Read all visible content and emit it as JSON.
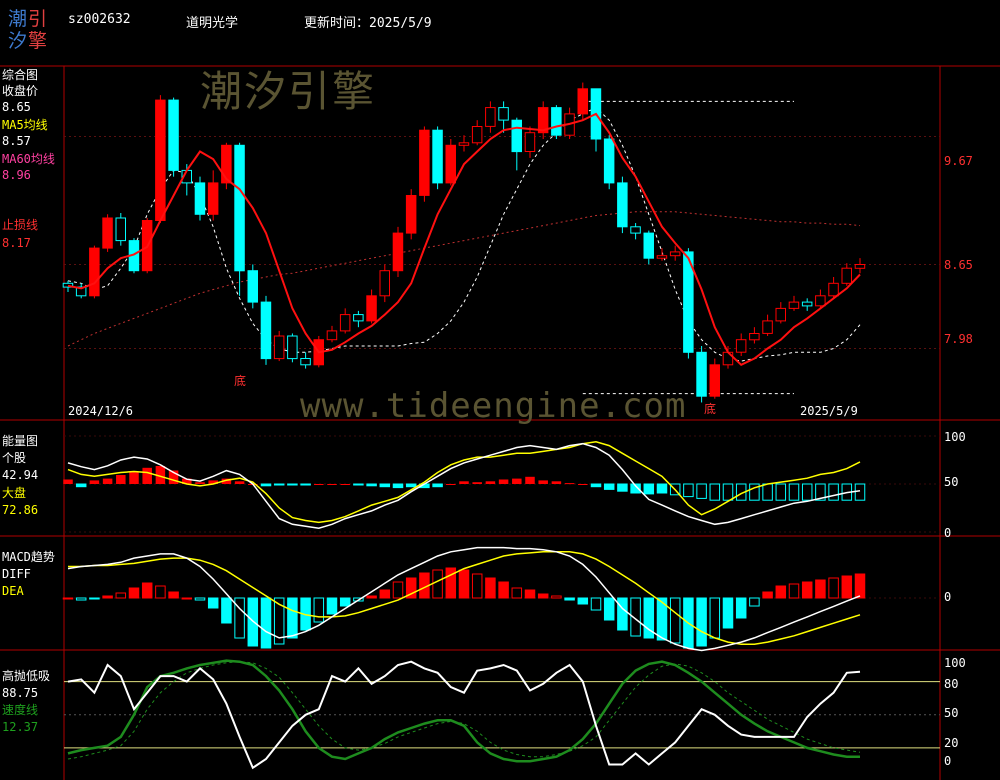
{
  "header": {
    "logo_chars": [
      "潮",
      "引",
      "汐",
      "擎"
    ],
    "code": "sz002632",
    "name": "道明光学",
    "update_label": "更新时间：",
    "update_date": "2025/5/9"
  },
  "watermark": {
    "text_cn": "潮汐引擎",
    "url": "www.tideengine.com"
  },
  "colors": {
    "up": "#ff0000",
    "down": "#00ffff",
    "ma5": "#ffffff",
    "ma60": "#ff3030",
    "stop": "#ff0000",
    "yellow": "#ffff00",
    "green": "#1e8c1e",
    "axis": "#b00000"
  },
  "panel_main": {
    "labels": {
      "title": "综合图",
      "close_label": "收盘价",
      "close_value": "8.65",
      "ma5_label": "MA5均线",
      "ma5_value": "8.57",
      "ma60_label": "MA60均线",
      "ma60_value": "8.96",
      "stop_label": "止损线",
      "stop_value": "8.17"
    },
    "start_date": "2024/12/6",
    "end_date": "2025/5/9",
    "bottom_markers": [
      {
        "label": "底",
        "index": 10
      },
      {
        "label": "底",
        "index": 39
      }
    ]
  },
  "panel_energy": {
    "labels": {
      "title": "能量图",
      "stock_label": "个股",
      "stock_value": "42.94",
      "market_label": "大盘",
      "market_value": "72.86"
    }
  },
  "panel_macd": {
    "labels": {
      "title": "MACD趋势",
      "diff_label": "DIFF",
      "dea_label": "DEA"
    }
  },
  "panel_gd": {
    "labels": {
      "title": "高抛低吸",
      "value1": "88.75",
      "speed_label": "速度线",
      "speed_value": "12.37"
    }
  },
  "chart_data": [
    {
      "name": "综合图",
      "type": "candlestick",
      "x_start": "2024/12/6",
      "x_end": "2025/5/9",
      "y_ticks": [
        "9.67",
        "8.65",
        "7.98"
      ],
      "candles": [
        [
          8.5,
          8.47,
          8.52,
          8.43
        ],
        [
          8.47,
          8.4,
          8.5,
          8.38
        ],
        [
          8.4,
          8.78,
          8.8,
          8.38
        ],
        [
          8.78,
          9.02,
          9.05,
          8.75
        ],
        [
          9.02,
          8.84,
          9.06,
          8.8
        ],
        [
          8.84,
          8.6,
          8.86,
          8.58
        ],
        [
          8.6,
          9.0,
          9.02,
          8.58
        ],
        [
          9.0,
          9.96,
          10.0,
          8.98
        ],
        [
          9.96,
          9.4,
          9.98,
          9.35
        ],
        [
          9.4,
          9.3,
          9.45,
          9.2
        ],
        [
          9.3,
          9.05,
          9.35,
          9.0
        ],
        [
          9.05,
          9.3,
          9.4,
          9.0
        ],
        [
          9.3,
          9.6,
          9.62,
          9.25
        ],
        [
          9.6,
          8.6,
          9.62,
          8.4
        ],
        [
          8.6,
          8.35,
          8.65,
          8.3
        ],
        [
          8.35,
          7.9,
          8.4,
          7.85
        ],
        [
          7.9,
          8.08,
          8.12,
          7.88
        ],
        [
          8.08,
          7.9,
          8.1,
          7.87
        ],
        [
          7.9,
          7.85,
          7.95,
          7.82
        ],
        [
          7.85,
          8.05,
          8.08,
          7.83
        ],
        [
          8.05,
          8.12,
          8.16,
          8.03
        ],
        [
          8.12,
          8.25,
          8.3,
          8.1
        ],
        [
          8.25,
          8.2,
          8.28,
          8.15
        ],
        [
          8.2,
          8.4,
          8.45,
          8.18
        ],
        [
          8.4,
          8.6,
          8.65,
          8.35
        ],
        [
          8.6,
          8.9,
          8.95,
          8.55
        ],
        [
          8.9,
          9.2,
          9.25,
          8.85
        ],
        [
          9.2,
          9.72,
          9.75,
          9.15
        ],
        [
          9.72,
          9.3,
          9.75,
          9.25
        ],
        [
          9.3,
          9.6,
          9.65,
          9.28
        ],
        [
          9.6,
          9.62,
          9.68,
          9.55
        ],
        [
          9.62,
          9.75,
          9.8,
          9.6
        ],
        [
          9.75,
          9.9,
          9.95,
          9.7
        ],
        [
          9.9,
          9.8,
          9.95,
          9.7
        ],
        [
          9.8,
          9.55,
          9.82,
          9.4
        ],
        [
          9.55,
          9.7,
          9.75,
          9.5
        ],
        [
          9.7,
          9.9,
          9.95,
          9.65
        ],
        [
          9.9,
          9.68,
          9.92,
          9.65
        ],
        [
          9.68,
          9.85,
          9.9,
          9.65
        ],
        [
          9.85,
          10.05,
          10.1,
          9.8
        ],
        [
          10.05,
          9.65,
          10.05,
          9.55
        ],
        [
          9.65,
          9.3,
          9.68,
          9.25
        ],
        [
          9.3,
          8.95,
          9.35,
          8.9
        ],
        [
          8.95,
          8.9,
          8.98,
          8.85
        ],
        [
          8.9,
          8.7,
          8.92,
          8.65
        ],
        [
          8.7,
          8.72,
          8.78,
          8.68
        ],
        [
          8.72,
          8.75,
          8.8,
          8.68
        ],
        [
          8.75,
          7.95,
          8.78,
          7.9
        ],
        [
          7.95,
          7.6,
          8.0,
          7.55
        ],
        [
          7.6,
          7.85,
          7.9,
          7.58
        ],
        [
          7.85,
          7.95,
          8.0,
          7.82
        ],
        [
          7.95,
          8.05,
          8.1,
          7.92
        ],
        [
          8.05,
          8.1,
          8.15,
          8.02
        ],
        [
          8.1,
          8.2,
          8.25,
          8.08
        ],
        [
          8.2,
          8.3,
          8.35,
          8.18
        ],
        [
          8.3,
          8.35,
          8.4,
          8.28
        ],
        [
          8.35,
          8.32,
          8.38,
          8.28
        ],
        [
          8.32,
          8.4,
          8.45,
          8.3
        ],
        [
          8.4,
          8.5,
          8.55,
          8.38
        ],
        [
          8.5,
          8.62,
          8.66,
          8.48
        ],
        [
          8.62,
          8.65,
          8.7,
          8.58
        ]
      ],
      "ma5": [
        8.48,
        8.46,
        8.5,
        8.62,
        8.7,
        8.73,
        8.79,
        9.0,
        9.2,
        9.4,
        9.55,
        9.49,
        9.33,
        9.25,
        9.1,
        8.9,
        8.6,
        8.3,
        8.1,
        7.95,
        7.97,
        8.03,
        8.1,
        8.16,
        8.25,
        8.35,
        8.5,
        8.78,
        9.05,
        9.25,
        9.45,
        9.55,
        9.65,
        9.72,
        9.74,
        9.73,
        9.72,
        9.75,
        9.77,
        9.8,
        9.85,
        9.7,
        9.5,
        9.35,
        9.15,
        8.95,
        8.82,
        8.7,
        8.45,
        8.15,
        7.95,
        7.85,
        7.9,
        7.98,
        8.05,
        8.15,
        8.22,
        8.3,
        8.38,
        8.46,
        8.57
      ],
      "ma60": [
        8.0,
        8.05,
        8.1,
        8.14,
        8.18,
        8.22,
        8.26,
        8.3,
        8.34,
        8.38,
        8.42,
        8.45,
        8.48,
        8.51,
        8.53,
        8.55,
        8.57,
        8.58,
        8.6,
        8.62,
        8.64,
        8.66,
        8.68,
        8.7,
        8.72,
        8.74,
        8.76,
        8.78,
        8.8,
        8.82,
        8.84,
        8.86,
        8.88,
        8.9,
        8.92,
        8.94,
        8.96,
        8.98,
        9.0,
        9.02,
        9.04,
        9.05,
        9.06,
        9.07,
        9.07,
        9.07,
        9.07,
        9.06,
        9.05,
        9.04,
        9.03,
        9.02,
        9.01,
        9.0,
        8.99,
        8.99,
        8.98,
        8.98,
        8.97,
        8.97,
        8.96
      ],
      "stop": [
        8.52,
        8.5,
        8.45,
        8.48,
        8.62,
        8.78,
        9.05,
        9.25,
        9.4,
        9.38,
        9.2,
        8.95,
        8.62,
        8.38,
        8.18,
        8.05,
        7.98,
        7.95,
        7.95,
        7.96,
        7.98,
        8.0,
        8.0,
        8.0,
        8.0,
        8.0,
        8.02,
        8.03,
        8.1,
        8.2,
        8.35,
        8.55,
        8.8,
        9.05,
        9.25,
        9.45,
        9.6,
        9.7,
        9.8,
        9.85,
        9.9,
        9.8,
        9.6,
        9.35,
        9.05,
        8.75,
        8.45,
        8.2,
        8.05,
        7.95,
        7.9,
        7.88,
        7.9,
        7.92,
        7.93,
        7.95,
        7.95,
        7.95,
        7.98,
        8.05,
        8.17
      ],
      "high_line": {
        "value": 9.95,
        "dashed": true
      },
      "low_line": {
        "value": 7.62,
        "dashed": true
      }
    },
    {
      "name": "能量图",
      "type": "line+bar",
      "y_ticks": [
        "100",
        "50",
        "0"
      ],
      "stock": [
        72,
        68,
        65,
        69,
        75,
        78,
        76,
        70,
        62,
        55,
        53,
        58,
        64,
        60,
        50,
        32,
        14,
        8,
        6,
        4,
        8,
        14,
        18,
        22,
        28,
        33,
        42,
        50,
        58,
        66,
        72,
        76,
        80,
        84,
        88,
        90,
        88,
        86,
        90,
        92,
        88,
        80,
        65,
        48,
        34,
        28,
        22,
        16,
        12,
        8,
        10,
        14,
        18,
        22,
        26,
        30,
        32,
        35,
        38,
        41,
        43
      ],
      "market": [
        65,
        60,
        58,
        60,
        62,
        63,
        62,
        58,
        54,
        50,
        48,
        50,
        54,
        56,
        52,
        40,
        25,
        15,
        12,
        10,
        12,
        16,
        22,
        28,
        32,
        36,
        44,
        52,
        62,
        70,
        75,
        78,
        78,
        80,
        82,
        82,
        84,
        86,
        88,
        92,
        94,
        90,
        82,
        74,
        66,
        58,
        44,
        28,
        18,
        24,
        32,
        40,
        46,
        50,
        52,
        54,
        56,
        60,
        62,
        66,
        73
      ],
      "bars": [
        5,
        -3,
        4,
        6,
        10,
        14,
        18,
        20,
        15,
        6,
        2,
        4,
        6,
        3,
        0,
        -2,
        -1,
        -1,
        -1,
        0,
        0,
        0,
        -1,
        -2,
        -3,
        -4,
        -3,
        -4,
        -3,
        0,
        3,
        2,
        3,
        5,
        6,
        8,
        4,
        3,
        1,
        0,
        -3,
        -6,
        -8,
        -10,
        -11,
        -10,
        -12,
        -14,
        -16,
        -18,
        -18,
        -18,
        -18,
        -18,
        -18,
        -18,
        -18,
        -18,
        -18,
        -18,
        -18
      ]
    },
    {
      "name": "MACD趋势",
      "type": "line+bar",
      "y_ticks": [
        "0"
      ],
      "diff": [
        0.28,
        0.3,
        0.31,
        0.32,
        0.34,
        0.38,
        0.4,
        0.42,
        0.42,
        0.38,
        0.3,
        0.18,
        0.04,
        -0.1,
        -0.22,
        -0.32,
        -0.38,
        -0.36,
        -0.32,
        -0.26,
        -0.18,
        -0.1,
        -0.02,
        0.06,
        0.14,
        0.22,
        0.28,
        0.34,
        0.4,
        0.44,
        0.46,
        0.48,
        0.48,
        0.48,
        0.47,
        0.47,
        0.46,
        0.44,
        0.4,
        0.32,
        0.2,
        0.05,
        -0.1,
        -0.2,
        -0.3,
        -0.38,
        -0.44,
        -0.48,
        -0.5,
        -0.48,
        -0.45,
        -0.42,
        -0.38,
        -0.33,
        -0.28,
        -0.23,
        -0.18,
        -0.13,
        -0.08,
        -0.03,
        0.02
      ],
      "dea": [
        0.3,
        0.3,
        0.31,
        0.31,
        0.32,
        0.33,
        0.35,
        0.37,
        0.38,
        0.38,
        0.36,
        0.32,
        0.26,
        0.18,
        0.1,
        0.02,
        -0.06,
        -0.12,
        -0.16,
        -0.18,
        -0.18,
        -0.17,
        -0.14,
        -0.1,
        -0.06,
        -0.02,
        0.04,
        0.1,
        0.16,
        0.22,
        0.28,
        0.32,
        0.36,
        0.4,
        0.42,
        0.43,
        0.44,
        0.44,
        0.44,
        0.42,
        0.37,
        0.3,
        0.22,
        0.14,
        0.05,
        -0.04,
        -0.14,
        -0.24,
        -0.32,
        -0.38,
        -0.42,
        -0.44,
        -0.44,
        -0.42,
        -0.39,
        -0.36,
        -0.32,
        -0.28,
        -0.24,
        -0.2,
        -0.16
      ],
      "bars": [
        0.0,
        -0.02,
        -0.01,
        0.02,
        0.05,
        0.1,
        0.15,
        0.12,
        0.06,
        0.0,
        -0.02,
        -0.1,
        -0.25,
        -0.4,
        -0.48,
        -0.5,
        -0.46,
        -0.4,
        -0.32,
        -0.24,
        -0.16,
        -0.08,
        -0.03,
        0.02,
        0.08,
        0.16,
        0.2,
        0.25,
        0.28,
        0.3,
        0.28,
        0.24,
        0.2,
        0.16,
        0.1,
        0.08,
        0.04,
        0.02,
        -0.02,
        -0.06,
        -0.12,
        -0.22,
        -0.32,
        -0.38,
        -0.4,
        -0.42,
        -0.45,
        -0.5,
        -0.48,
        -0.4,
        -0.3,
        -0.2,
        -0.08,
        0.06,
        0.12,
        0.14,
        0.16,
        0.18,
        0.2,
        0.22,
        0.24
      ]
    },
    {
      "name": "高抛低吸",
      "type": "line",
      "y_ticks": [
        "100",
        "80",
        "50",
        "20",
        "0"
      ],
      "line_white": [
        80,
        82,
        70,
        95,
        85,
        55,
        70,
        85,
        85,
        80,
        92,
        82,
        60,
        30,
        2,
        10,
        25,
        40,
        50,
        55,
        85,
        80,
        92,
        78,
        85,
        95,
        98,
        92,
        88,
        75,
        70,
        90,
        92,
        95,
        90,
        72,
        78,
        88,
        95,
        80,
        40,
        5,
        5,
        15,
        5,
        15,
        25,
        40,
        55,
        50,
        40,
        32,
        30,
        30,
        30,
        30,
        48,
        60,
        70,
        88,
        89
      ],
      "line_green": [
        15,
        18,
        20,
        22,
        30,
        50,
        75,
        85,
        88,
        92,
        95,
        97,
        99,
        98,
        95,
        85,
        72,
        55,
        35,
        20,
        12,
        10,
        15,
        20,
        28,
        34,
        38,
        42,
        45,
        45,
        40,
        25,
        15,
        10,
        8,
        8,
        10,
        12,
        18,
        28,
        42,
        60,
        78,
        90,
        96,
        98,
        95,
        88,
        80,
        70,
        60,
        50,
        42,
        35,
        30,
        25,
        20,
        17,
        14,
        12,
        12
      ],
      "line_green_dashed": [
        10,
        12,
        15,
        18,
        22,
        35,
        55,
        70,
        80,
        88,
        92,
        95,
        97,
        98,
        97,
        92,
        84,
        70,
        55,
        40,
        28,
        20,
        18,
        20,
        24,
        30,
        34,
        38,
        42,
        44,
        42,
        35,
        25,
        18,
        14,
        12,
        12,
        14,
        17,
        22,
        30,
        45,
        60,
        75,
        86,
        94,
        96,
        94,
        88,
        80,
        70,
        62,
        54,
        46,
        40,
        34,
        28,
        24,
        20,
        18,
        16
      ]
    }
  ]
}
